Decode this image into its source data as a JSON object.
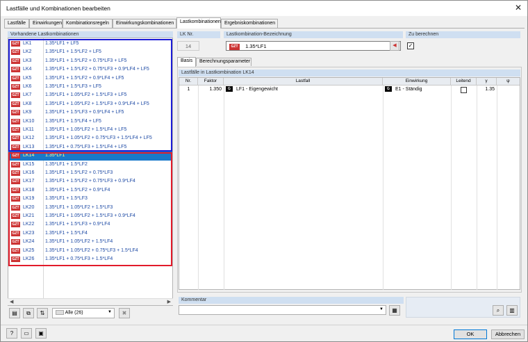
{
  "window": {
    "title": "Lastfälle und Kombinationen bearbeiten",
    "close_glyph": "✕"
  },
  "tabs": [
    "Lastfälle",
    "Einwirkungen",
    "Kombinationsregeln",
    "Einwirkungskombinationen",
    "Lastkombinationen",
    "Ergebniskombinationen"
  ],
  "active_tab": "Lastkombinationen",
  "left_panel": {
    "header": "Vorhandene Lastkombinationen",
    "badge": "GZT",
    "items": [
      {
        "id": "LK1",
        "formula": "1.35*LF1 + LF5"
      },
      {
        "id": "LK2",
        "formula": "1.35*LF1 + 1.5*LF2 + LF5"
      },
      {
        "id": "LK3",
        "formula": "1.35*LF1 + 1.5*LF2 + 0.75*LF3 + LF5"
      },
      {
        "id": "LK4",
        "formula": "1.35*LF1 + 1.5*LF2 + 0.75*LF3 + 0.9*LF4 + LF5"
      },
      {
        "id": "LK5",
        "formula": "1.35*LF1 + 1.5*LF2 + 0.9*LF4 + LF5"
      },
      {
        "id": "LK6",
        "formula": "1.35*LF1 + 1.5*LF3 + LF5"
      },
      {
        "id": "LK7",
        "formula": "1.35*LF1 + 1.05*LF2 + 1.5*LF3 + LF5"
      },
      {
        "id": "LK8",
        "formula": "1.35*LF1 + 1.05*LF2 + 1.5*LF3 + 0.9*LF4 + LF5"
      },
      {
        "id": "LK9",
        "formula": "1.35*LF1 + 1.5*LF3 + 0.9*LF4 + LF5"
      },
      {
        "id": "LK10",
        "formula": "1.35*LF1 + 1.5*LF4 + LF5"
      },
      {
        "id": "LK11",
        "formula": "1.35*LF1 + 1.05*LF2 + 1.5*LF4 + LF5"
      },
      {
        "id": "LK12",
        "formula": "1.35*LF1 + 1.05*LF2 + 0.75*LF3 + 1.5*LF4 + LF5"
      },
      {
        "id": "LK13",
        "formula": "1.35*LF1 + 0.75*LF3 + 1.5*LF4 + LF5"
      },
      {
        "id": "LK14",
        "formula": "1.35*LF1"
      },
      {
        "id": "LK15",
        "formula": "1.35*LF1 + 1.5*LF2"
      },
      {
        "id": "LK16",
        "formula": "1.35*LF1 + 1.5*LF2 + 0.75*LF3"
      },
      {
        "id": "LK17",
        "formula": "1.35*LF1 + 1.5*LF2 + 0.75*LF3 + 0.9*LF4"
      },
      {
        "id": "LK18",
        "formula": "1.35*LF1 + 1.5*LF2 + 0.9*LF4"
      },
      {
        "id": "LK19",
        "formula": "1.35*LF1 + 1.5*LF3"
      },
      {
        "id": "LK20",
        "formula": "1.35*LF1 + 1.05*LF2 + 1.5*LF3"
      },
      {
        "id": "LK21",
        "formula": "1.35*LF1 + 1.05*LF2 + 1.5*LF3 + 0.9*LF4"
      },
      {
        "id": "LK22",
        "formula": "1.35*LF1 + 1.5*LF3 + 0.9*LF4"
      },
      {
        "id": "LK23",
        "formula": "1.35*LF1 + 1.5*LF4"
      },
      {
        "id": "LK24",
        "formula": "1.35*LF1 + 1.05*LF2 + 1.5*LF4"
      },
      {
        "id": "LK25",
        "formula": "1.35*LF1 + 1.05*LF2 + 0.75*LF3 + 1.5*LF4"
      },
      {
        "id": "LK26",
        "formula": "1.35*LF1 + 0.75*LF3 + 1.5*LF4"
      }
    ],
    "selected": "LK14",
    "filter": "Alle (26)"
  },
  "detail": {
    "lk_nr_label": "LK Nr.",
    "lk_nr_value": "14",
    "name_label": "Lastkombination-Bezeichnung",
    "name_badge": "GZT",
    "name_value": "1.35*LF1",
    "calc_label": "Zu berechnen",
    "calc_checked": "✓",
    "subtabs": [
      "Basis",
      "Berechnungsparameter"
    ],
    "table_header": "Lastfälle in Lastkombination LK14",
    "columns": [
      "Nr.",
      "Faktor",
      "Lastfall",
      "Einwirkung",
      "Leitend",
      "γ",
      "ψ"
    ],
    "rows": [
      {
        "nr": "1",
        "faktor": "1.350",
        "lf_tag": "G",
        "lastfall": "LF1 - Eigengewicht",
        "ew_tag": "G",
        "einwirkung": "E1 - Ständig",
        "gamma": "1.35"
      }
    ],
    "comment_label": "Kommentar"
  },
  "footer": {
    "ok": "OK",
    "cancel": "Abbrechen"
  }
}
